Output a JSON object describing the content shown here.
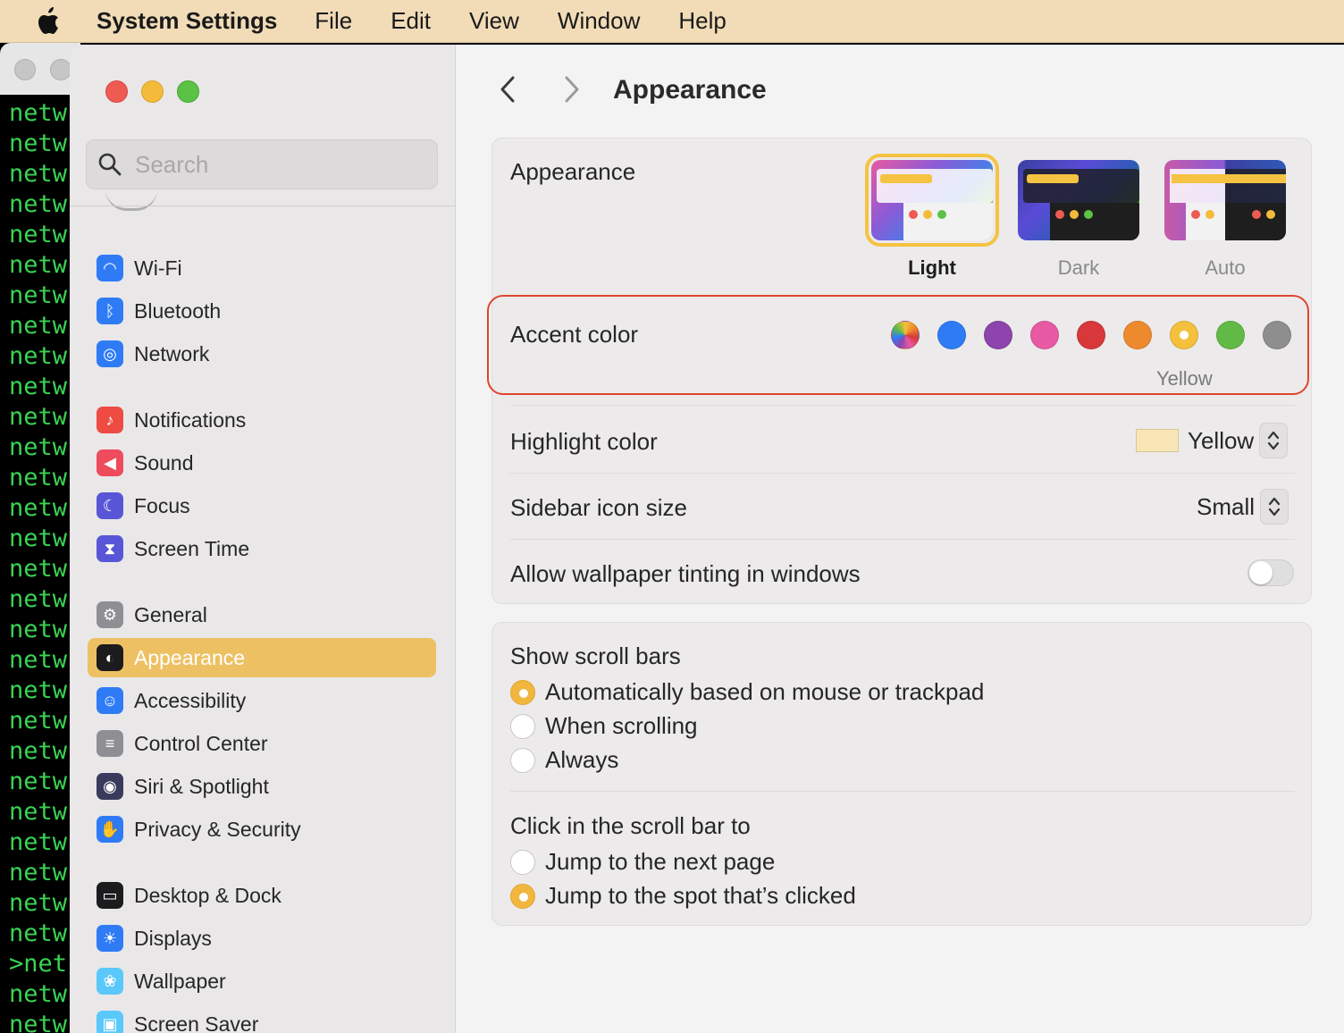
{
  "menubar": {
    "apple_icon": "apple-logo",
    "app_name": "System Settings",
    "items": [
      "File",
      "Edit",
      "View",
      "Window",
      "Help"
    ]
  },
  "terminal": {
    "lines": [
      "netw",
      "netw",
      "netw",
      "netw",
      "netw",
      "netw",
      "netw",
      "netw",
      "netw",
      "netw",
      "netw",
      "netw",
      "netw",
      "netw",
      "netw",
      "netw",
      "netw",
      "netw",
      "netw",
      "netw",
      "netw",
      "netw",
      "netw",
      "netw",
      "netw",
      "netw",
      "netw",
      "netw",
      ">net",
      "netw",
      "netw"
    ]
  },
  "sidebar": {
    "search_placeholder": "Search",
    "items": [
      {
        "label": "Wi-Fi",
        "icon": "wifi-icon",
        "color": "#2f7bf6"
      },
      {
        "label": "Bluetooth",
        "icon": "bluetooth-icon",
        "color": "#2f7bf6"
      },
      {
        "label": "Network",
        "icon": "globe-icon",
        "color": "#2f7bf6"
      },
      {
        "label": "Notifications",
        "icon": "bell-icon",
        "color": "#ee4b43"
      },
      {
        "label": "Sound",
        "icon": "speaker-icon",
        "color": "#ee4b5c"
      },
      {
        "label": "Focus",
        "icon": "moon-icon",
        "color": "#5856d6"
      },
      {
        "label": "Screen Time",
        "icon": "hourglass-icon",
        "color": "#5856d6"
      },
      {
        "label": "General",
        "icon": "gear-icon",
        "color": "#8e8e93"
      },
      {
        "label": "Appearance",
        "icon": "appearance-icon",
        "color": "#1c1c1e",
        "selected": true
      },
      {
        "label": "Accessibility",
        "icon": "accessibility-icon",
        "color": "#2f7bf6"
      },
      {
        "label": "Control Center",
        "icon": "control-center-icon",
        "color": "#8e8e93"
      },
      {
        "label": "Siri & Spotlight",
        "icon": "siri-icon",
        "color": "#3a3a5c"
      },
      {
        "label": "Privacy & Security",
        "icon": "hand-icon",
        "color": "#2f7bf6"
      },
      {
        "label": "Desktop & Dock",
        "icon": "dock-icon",
        "color": "#1c1c1e"
      },
      {
        "label": "Displays",
        "icon": "sun-icon",
        "color": "#2f7bf6"
      },
      {
        "label": "Wallpaper",
        "icon": "flower-icon",
        "color": "#5ac8fa"
      },
      {
        "label": "Screen Saver",
        "icon": "screensaver-icon",
        "color": "#5ac8fa"
      }
    ]
  },
  "main": {
    "title": "Appearance",
    "appearance": {
      "label": "Appearance",
      "options": [
        "Light",
        "Dark",
        "Auto"
      ],
      "selected": "Light"
    },
    "accent": {
      "label": "Accent color",
      "colors": [
        "multicolor",
        "#2f7bf6",
        "#8e44ad",
        "#e85aa3",
        "#d8383a",
        "#ee8a2e",
        "#f5c03c",
        "#62ba46",
        "#8e8e8e"
      ],
      "selected_index": 6,
      "selected_name": "Yellow"
    },
    "highlight": {
      "label": "Highlight color",
      "value": "Yellow",
      "swatch": "#f8e6b6"
    },
    "sidebar_icon_size": {
      "label": "Sidebar icon size",
      "value": "Small"
    },
    "wallpaper_tinting": {
      "label": "Allow wallpaper tinting in windows",
      "enabled": false
    },
    "scroll_bars": {
      "title": "Show scroll bars",
      "options": [
        "Automatically based on mouse or trackpad",
        "When scrolling",
        "Always"
      ],
      "selected_index": 0
    },
    "click_scroll_bar": {
      "title": "Click in the scroll bar to",
      "options": [
        "Jump to the next page",
        "Jump to the spot that’s clicked"
      ],
      "selected_index": 1
    },
    "help": "?"
  }
}
